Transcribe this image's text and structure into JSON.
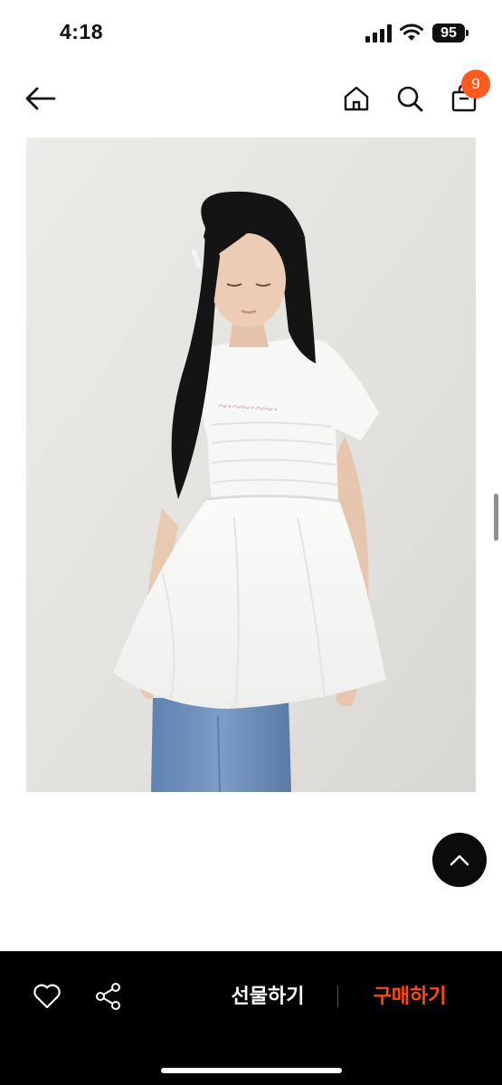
{
  "status_bar": {
    "time": "4:18",
    "battery": "95",
    "icons": [
      "signal-icon",
      "wifi-icon",
      "battery-icon"
    ]
  },
  "nav": {
    "icons": [
      "back-arrow-icon",
      "home-icon",
      "search-icon",
      "shopping-bag-icon"
    ],
    "cart_count": "9",
    "badge_color": "#ff5a1f"
  },
  "product": {
    "image": "product-photo"
  },
  "bottom_bar": {
    "icons": [
      "heart-icon",
      "share-icon"
    ],
    "gift_label": "선물하기",
    "buy_label": "구매하기",
    "buy_color": "#ff4b10",
    "background": "#000000"
  },
  "floating": {
    "icon": "chevron-up-icon"
  }
}
